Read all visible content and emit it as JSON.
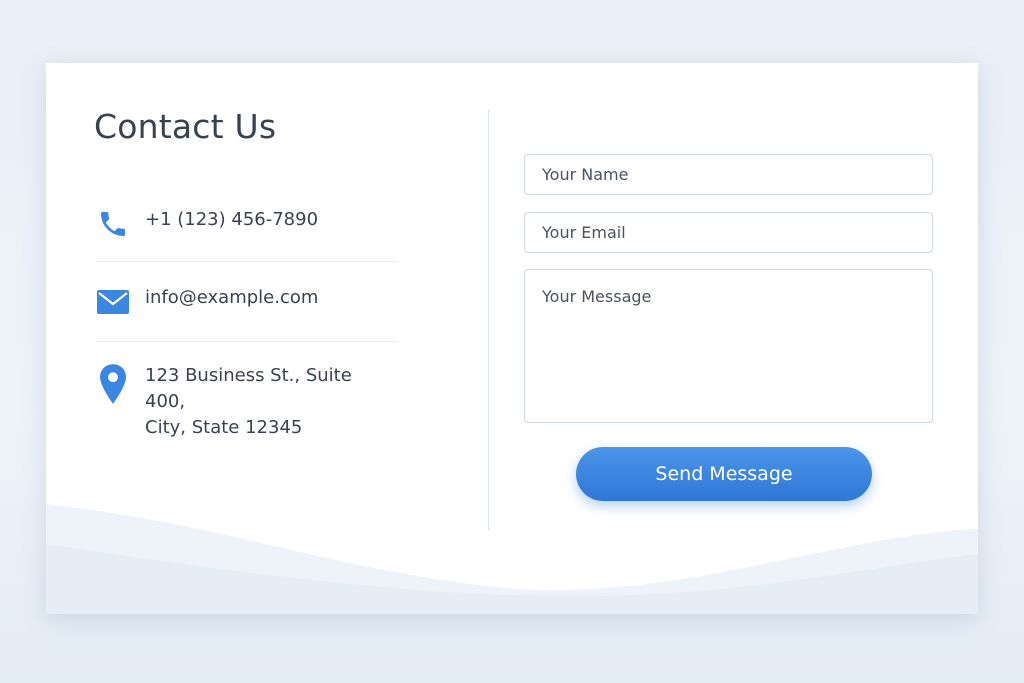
{
  "contact": {
    "title": "Contact Us",
    "phone": "+1 (123) 456-7890",
    "email": "info@example.com",
    "address_line1": "123 Business St., Suite 400,",
    "address_line2": "City, State 12345",
    "icons": {
      "phone": "phone-icon",
      "email": "envelope-icon",
      "address": "location-pin-icon"
    }
  },
  "form": {
    "name_placeholder": "Your Name",
    "email_placeholder": "Your Email",
    "message_placeholder": "Your Message",
    "name_value": "",
    "email_value": "",
    "message_value": "",
    "submit_label": "Send Message"
  },
  "colors": {
    "accent": "#3a86e0",
    "background": "#eaf0f7",
    "card": "#ffffff",
    "text": "#3a4250"
  }
}
